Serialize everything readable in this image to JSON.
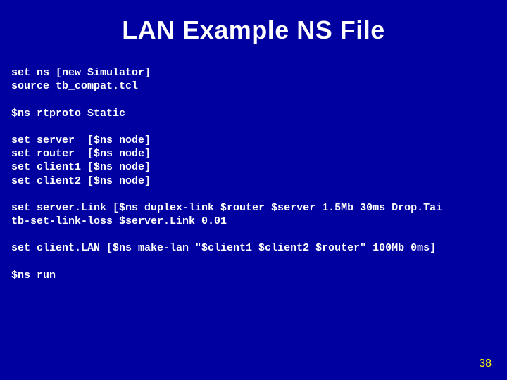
{
  "title": "LAN Example NS File",
  "code": {
    "l01": "set ns [new Simulator]",
    "l02": "source tb_compat.tcl",
    "l03": "",
    "l04": "$ns rtproto Static",
    "l05": "",
    "l06": "set server  [$ns node]",
    "l07": "set router  [$ns node]",
    "l08": "set client1 [$ns node]",
    "l09": "set client2 [$ns node]",
    "l10": "",
    "l11": "set server.Link [$ns duplex-link $router $server 1.5Mb 30ms Drop.Tai",
    "l12": "tb-set-link-loss $server.Link 0.01",
    "l13": "",
    "l14": "set client.LAN [$ns make-lan \"$client1 $client2 $router\" 100Mb 0ms]",
    "l15": "",
    "l16": "$ns run"
  },
  "page_number": "38"
}
